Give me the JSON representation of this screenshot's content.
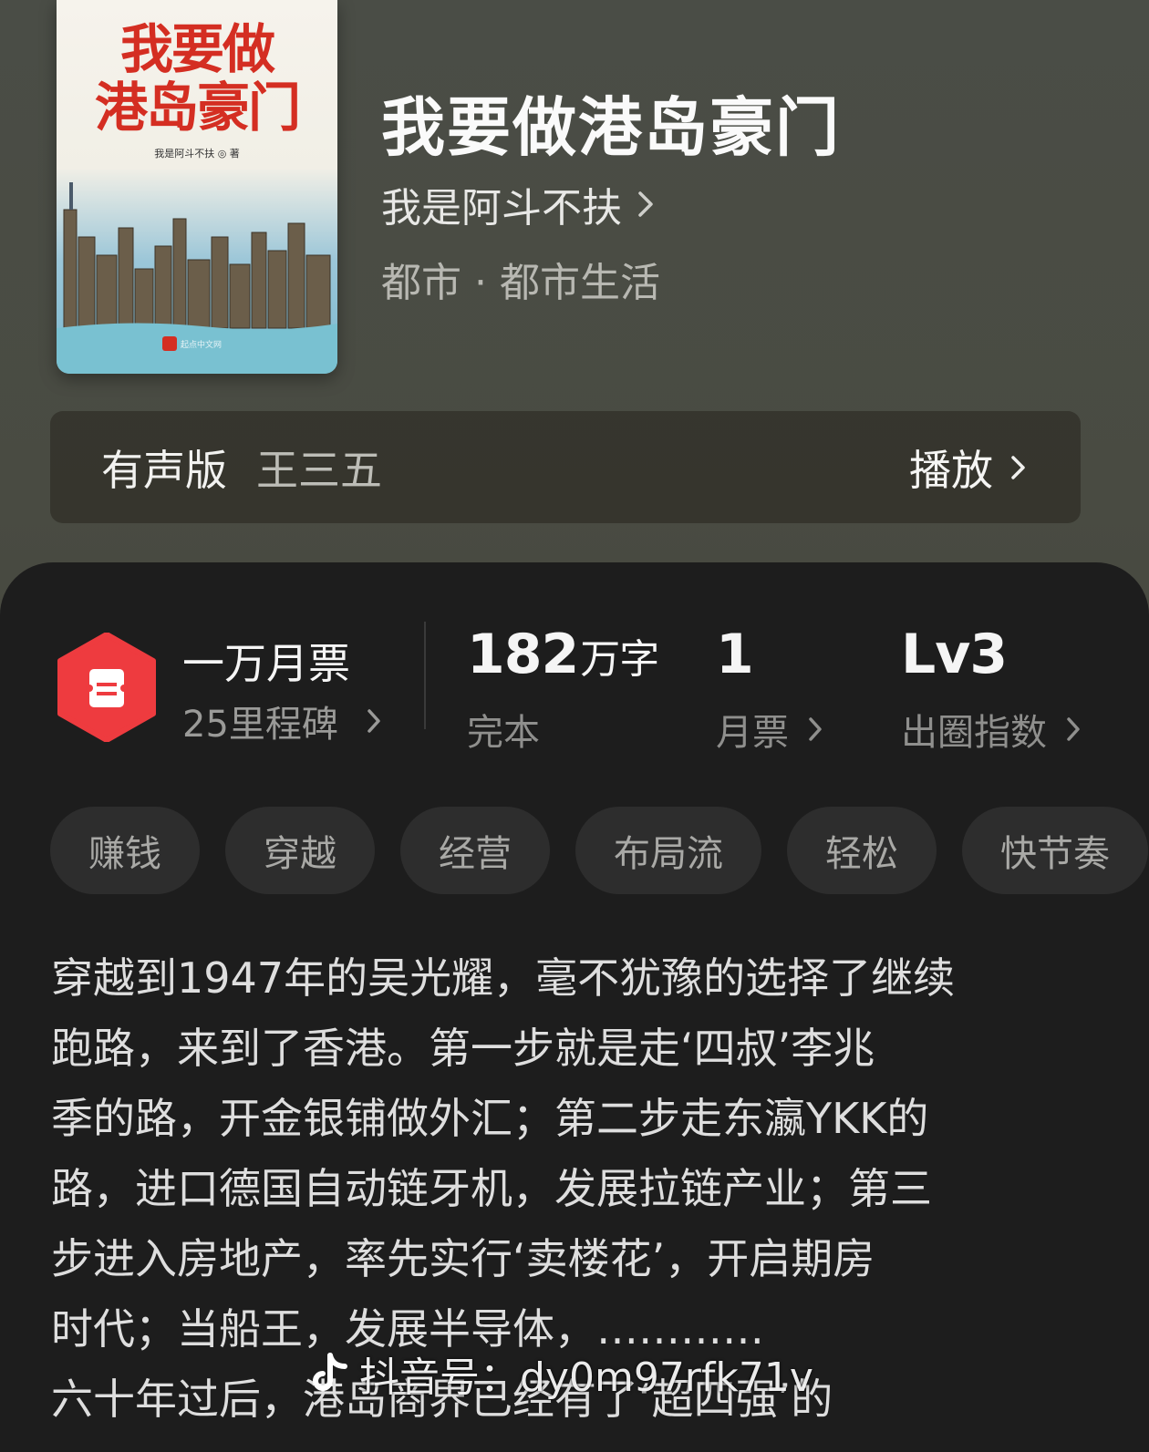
{
  "book": {
    "cover_title_line1": "我要做",
    "cover_title_line2": "港岛豪门",
    "cover_author": "我是阿斗不扶 ◎ 著",
    "cover_publisher": "起点中文网",
    "title": "我要做港岛豪门",
    "author": "我是阿斗不扶",
    "genre": "都市 · 都市生活"
  },
  "audio": {
    "label": "有声版",
    "narrator": "王三五",
    "play_label": "播放"
  },
  "stats": {
    "monthly_ticket_title": "一万月票",
    "milestone": "25里程碑",
    "word_count": "182",
    "word_unit": "万字",
    "status": "完本",
    "monthly_votes": "1",
    "monthly_votes_label": "月票",
    "level": "Lv3",
    "level_label": "出圈指数"
  },
  "tags": [
    "赚钱",
    "穿越",
    "经营",
    "布局流",
    "轻松",
    "快节奏"
  ],
  "synopsis_lines": [
    "穿越到1947年的吴光耀，毫不犹豫的选择了继续",
    "跑路，来到了香港。第一步就是走‘四叔’李兆",
    "季的路，开金银铺做外汇；第二步走东瀛YKK的",
    "路，进口德国自动链牙机，发展拉链产业；第三",
    "步进入房地产，率先实行‘卖楼花’，开启期房",
    "时代；当船王，发展半导体，…………",
    "六十年过后，港岛商界已经有了‘超四强’的"
  ],
  "watermark": "抖音号：dy0m97rfk71v",
  "colors": {
    "cover_red": "#d42e22",
    "ticket_red": "#ee3b3f",
    "panel_bg": "#1d1d1d",
    "tag_bg": "#2d2d2d"
  }
}
